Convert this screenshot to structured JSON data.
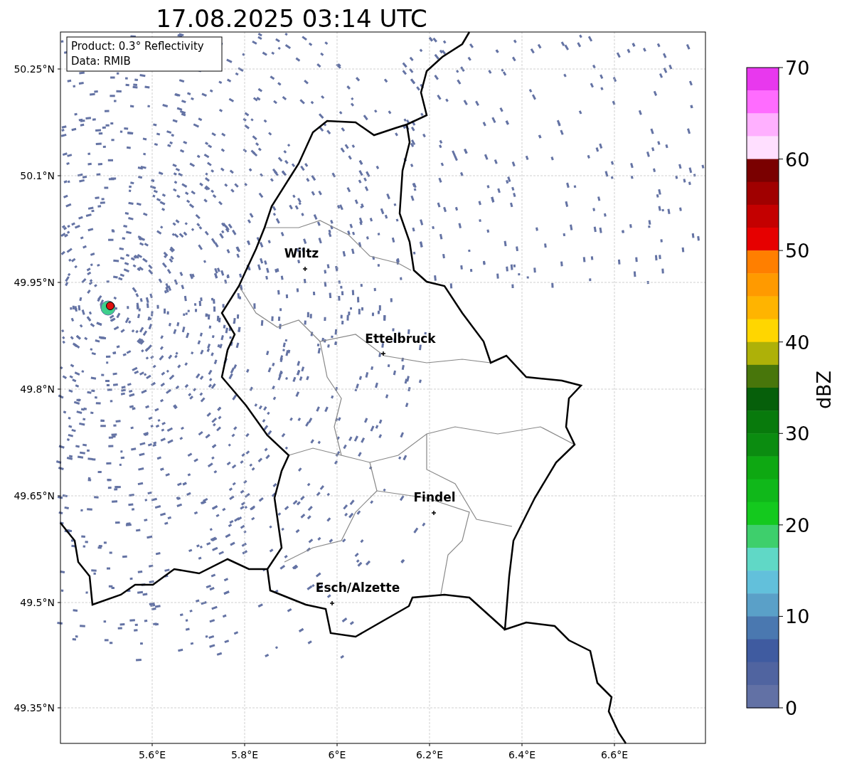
{
  "title": "17.08.2025 03:14 UTC",
  "info_box": {
    "lines": [
      "Product: 0.3° Reflectivity",
      "Data: RMIB"
    ]
  },
  "map": {
    "xticks": [
      "5.6°E",
      "5.8°E",
      "6°E",
      "6.2°E",
      "6.4°E",
      "6.6°E"
    ],
    "yticks": [
      "50.25°N",
      "50.1°N",
      "49.95°N",
      "49.8°N",
      "49.65°N",
      "49.5°N",
      "49.35°N"
    ],
    "cities": [
      {
        "name": "Wiltz"
      },
      {
        "name": "Ettelbruck"
      },
      {
        "name": "Findel"
      },
      {
        "name": "Esch/Alzette"
      }
    ]
  },
  "colorbar": {
    "label": "dBZ",
    "ticks": [
      "70",
      "60",
      "50",
      "40",
      "30",
      "20",
      "10",
      "0"
    ],
    "bins": [
      {
        "color": "#e838ee"
      },
      {
        "color": "#ff6cff"
      },
      {
        "color": "#ffb0ff"
      },
      {
        "color": "#ffdfff"
      },
      {
        "color": "#7a0000"
      },
      {
        "color": "#a00000"
      },
      {
        "color": "#c40000"
      },
      {
        "color": "#e60000"
      },
      {
        "color": "#ff7f00"
      },
      {
        "color": "#ff9a00"
      },
      {
        "color": "#ffb400"
      },
      {
        "color": "#ffd600"
      },
      {
        "color": "#aeb108"
      },
      {
        "color": "#48760b"
      },
      {
        "color": "#065f0a"
      },
      {
        "color": "#087a0c"
      },
      {
        "color": "#0b8c10"
      },
      {
        "color": "#0ea812"
      },
      {
        "color": "#10b81a"
      },
      {
        "color": "#14c91e"
      },
      {
        "color": "#3ecf6c"
      },
      {
        "color": "#60d8c6"
      },
      {
        "color": "#62c0db"
      },
      {
        "color": "#5aa0c8"
      },
      {
        "color": "#4a78b0"
      },
      {
        "color": "#3f5ba0"
      },
      {
        "color": "#5064a0"
      },
      {
        "color": "#6271a5"
      }
    ]
  }
}
